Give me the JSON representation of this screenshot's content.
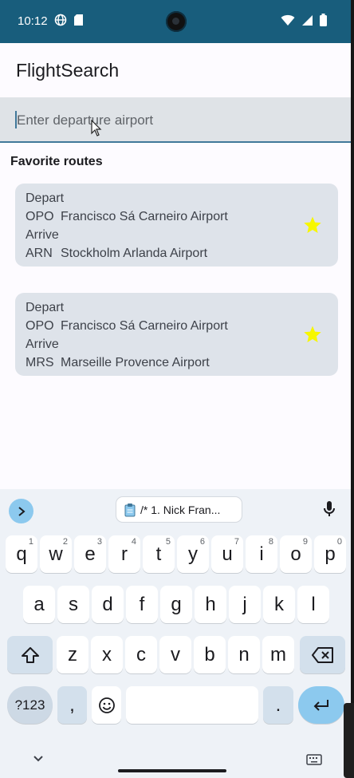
{
  "status_bar": {
    "time": "10:12"
  },
  "app": {
    "title": "FlightSearch"
  },
  "search": {
    "placeholder": "Enter departure airport",
    "value": ""
  },
  "favorites": {
    "heading": "Favorite routes",
    "routes": [
      {
        "depart_label": "Depart",
        "depart_code": "OPO",
        "depart_name": "Francisco Sá Carneiro Airport",
        "arrive_label": "Arrive",
        "arrive_code": "ARN",
        "arrive_name": "Stockholm Arlanda Airport",
        "favorite": true
      },
      {
        "depart_label": "Depart",
        "depart_code": "OPO",
        "depart_name": "Francisco Sá Carneiro Airport",
        "arrive_label": "Arrive",
        "arrive_code": "MRS",
        "arrive_name": "Marseille Provence Airport",
        "favorite": true
      }
    ]
  },
  "keyboard": {
    "clipboard_suggestion": "/* 1. Nick Fran...",
    "row1": [
      {
        "k": "q",
        "hint": "1"
      },
      {
        "k": "w",
        "hint": "2"
      },
      {
        "k": "e",
        "hint": "3"
      },
      {
        "k": "r",
        "hint": "4"
      },
      {
        "k": "t",
        "hint": "5"
      },
      {
        "k": "y",
        "hint": "6"
      },
      {
        "k": "u",
        "hint": "7"
      },
      {
        "k": "i",
        "hint": "8"
      },
      {
        "k": "o",
        "hint": "9"
      },
      {
        "k": "p",
        "hint": "0"
      }
    ],
    "row2": [
      "a",
      "s",
      "d",
      "f",
      "g",
      "h",
      "j",
      "k",
      "l"
    ],
    "row3": [
      "z",
      "x",
      "c",
      "v",
      "b",
      "n",
      "m"
    ],
    "symbols_label": "?123",
    "comma": ",",
    "period": "."
  },
  "colors": {
    "status_bar": "#185d7c",
    "accent": "#41789a",
    "card": "#dee3ea",
    "star": "#f7f700"
  }
}
